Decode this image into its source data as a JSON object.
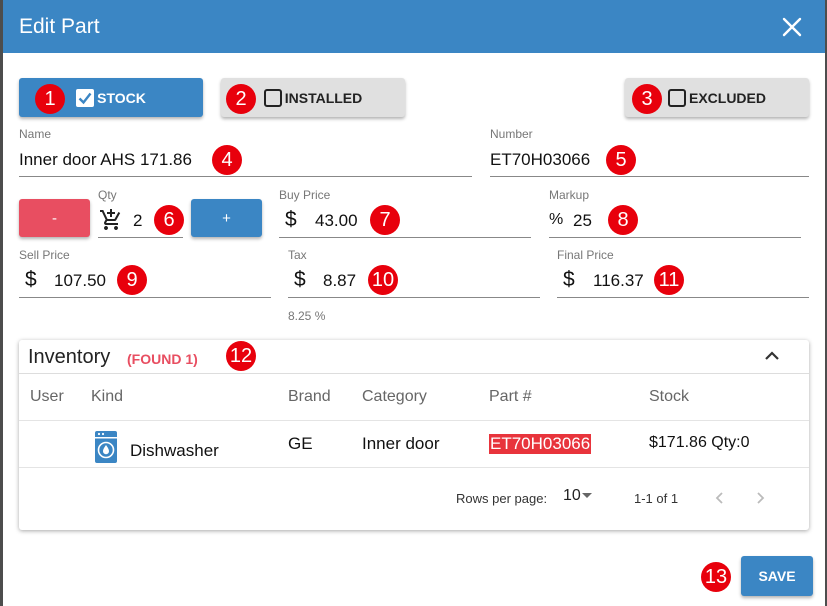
{
  "dialog": {
    "title": "Edit Part"
  },
  "toggles": {
    "stock": {
      "label": "STOCK",
      "checked": true
    },
    "installed": {
      "label": "INSTALLED",
      "checked": false
    },
    "excluded": {
      "label": "EXCLUDED",
      "checked": false
    }
  },
  "fields": {
    "name": {
      "label": "Name",
      "value": "Inner door AHS 171.86"
    },
    "number": {
      "label": "Number",
      "value": "ET70H03066"
    },
    "qty": {
      "label": "Qty",
      "value": "2",
      "minus": "-",
      "plus": "+"
    },
    "buy_price": {
      "label": "Buy Price",
      "prefix": "$",
      "value": "43.00"
    },
    "markup": {
      "label": "Markup",
      "prefix": "%",
      "value": "25"
    },
    "sell_price": {
      "label": "Sell Price",
      "prefix": "$",
      "value": "107.50"
    },
    "tax": {
      "label": "Tax",
      "prefix": "$",
      "value": "8.87",
      "hint": "8.25 %"
    },
    "final_price": {
      "label": "Final Price",
      "prefix": "$",
      "value": "116.37"
    }
  },
  "inventory": {
    "title": "Inventory",
    "found": "(FOUND 1)",
    "columns": [
      "User",
      "Kind",
      "Brand",
      "Category",
      "Part #",
      "Stock"
    ],
    "rows": [
      {
        "user": "",
        "kind": "Dishwasher",
        "brand": "GE",
        "category": "Inner door",
        "part": "ET70H03066",
        "stock": "$171.86 Qty:0"
      }
    ],
    "rows_per_page_label": "Rows per page:",
    "rows_per_page": "10",
    "range": "1-1 of 1"
  },
  "actions": {
    "save": "SAVE"
  },
  "badges": [
    "1",
    "2",
    "3",
    "4",
    "5",
    "6",
    "7",
    "8",
    "9",
    "10",
    "11",
    "12",
    "13"
  ],
  "colors": {
    "primary": "#3b86c4",
    "danger": "#e84e61",
    "badge": "#e8000c"
  }
}
